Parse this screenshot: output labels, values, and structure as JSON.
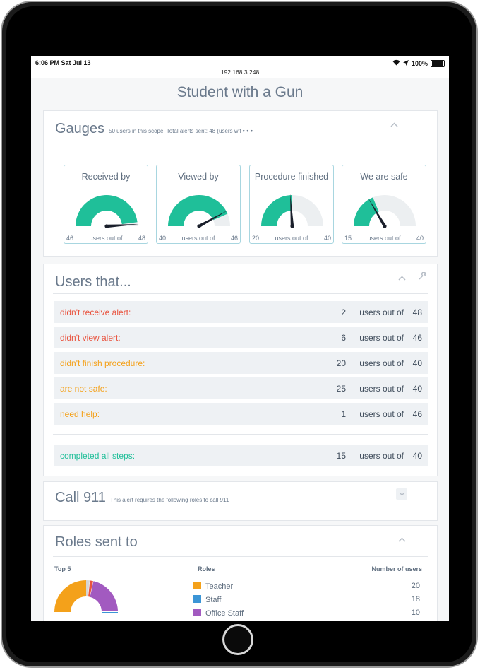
{
  "status": {
    "time": "6:06 PM   Sat Jul 13",
    "url": "192.168.3.248",
    "battery": "100%"
  },
  "page_title": "Student with a Gun",
  "gauges": {
    "title": "Gauges",
    "subtitle": "50 users in this scope. Total alerts sent: 48 (users wit",
    "ellipsis": "• • •",
    "colors": {
      "fill": "#1fbf99",
      "track": "#eceff1",
      "needle": "#1a1f2b"
    },
    "items": [
      {
        "title": "Received by",
        "min": "46",
        "label": "users out of",
        "max": "48",
        "value": 46,
        "total": 48,
        "needle": 0.98
      },
      {
        "title": "Viewed by",
        "min": "40",
        "label": "users out of",
        "max": "46",
        "value": 40,
        "total": 46,
        "needle": 0.84
      },
      {
        "title": "Procedure finished",
        "min": "20",
        "label": "users out of",
        "max": "40",
        "value": 20,
        "total": 40,
        "needle": 0.48
      },
      {
        "title": "We are safe",
        "min": "15",
        "label": "users out of",
        "max": "40",
        "value": 15,
        "total": 40,
        "needle": 0.33
      }
    ]
  },
  "users": {
    "title": "Users that...",
    "rows": [
      {
        "label": "didn't receive alert:",
        "count": "2",
        "of": "users out of",
        "total": "48",
        "color": "#e9543f"
      },
      {
        "label": "didn't view alert:",
        "count": "6",
        "of": "users out of",
        "total": "46",
        "color": "#e9543f"
      },
      {
        "label": "didn't finish procedure:",
        "count": "20",
        "of": "users out of",
        "total": "40",
        "color": "#f4a11a"
      },
      {
        "label": "are not safe:",
        "count": "25",
        "of": "users out of",
        "total": "40",
        "color": "#f4a11a"
      },
      {
        "label": "need help:",
        "count": "1",
        "of": "users out of",
        "total": "46",
        "color": "#f4a11a"
      }
    ],
    "completed": {
      "label": "completed all steps:",
      "count": "15",
      "of": "users out of",
      "total": "40",
      "color": "#1fbf99"
    }
  },
  "call911": {
    "title": "Call 911",
    "subtitle": "This alert requires the following roles to call 911"
  },
  "roles": {
    "title": "Roles sent to",
    "top5": "Top 5",
    "col_roles": "Roles",
    "col_users": "Number of users",
    "items": [
      {
        "name": "Teacher",
        "count": "20",
        "color": "#f4a11a"
      },
      {
        "name": "Staff",
        "count": "18",
        "color": "#3b95d6"
      },
      {
        "name": "Office Staff",
        "count": "10",
        "color": "#a25ac0"
      }
    ]
  }
}
